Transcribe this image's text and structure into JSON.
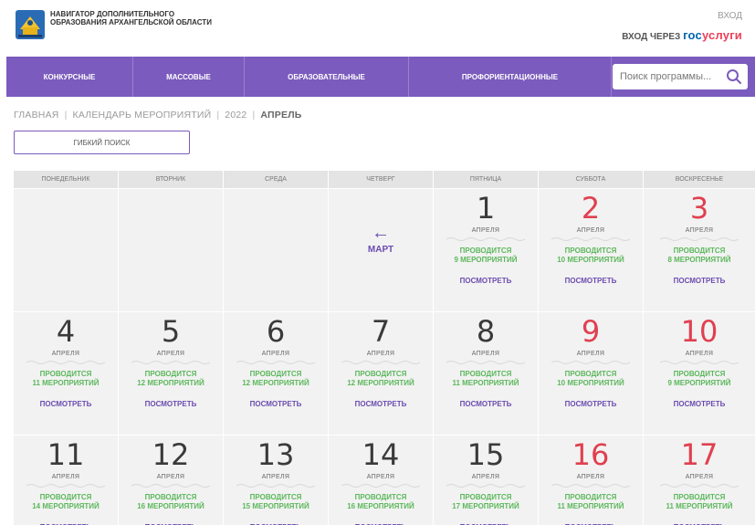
{
  "header": {
    "org_name": "НАВИГАТОР ДОПОЛНИТЕЛЬНОГО ОБРАЗОВАНИЯ АРХАНГЕЛЬСКОЙ ОБЛАСТИ",
    "login": "ВХОД",
    "login_via": "ВХОД ЧЕРЕЗ",
    "gos_part1": "гос",
    "gos_part2": "услуги"
  },
  "nav": {
    "items": [
      "КОНКУРСНЫЕ",
      "МАССОВЫЕ",
      "ОБРАЗОВАТЕЛЬНЫЕ",
      "ПРОФОРИЕНТАЦИОННЫЕ"
    ],
    "search_placeholder": "Поиск программы..."
  },
  "breadcrumb": {
    "items": [
      "ГЛАВНАЯ",
      "КАЛЕНДАРЬ МЕРОПРИЯТИЙ",
      "2022"
    ],
    "current": "АПРЕЛЬ"
  },
  "flex_search_label": "ГИБКИЙ ПОИСК",
  "calendar": {
    "weekdays": [
      "ПОНЕДЕЛЬНИК",
      "ВТОРНИК",
      "СРЕДА",
      "ЧЕТВЕРГ",
      "ПЯТНИЦА",
      "СУББОТА",
      "ВОСКРЕСЕНЬЕ"
    ],
    "prev_month_label": "МАРТ",
    "month_genitive": "АПРЕЛЯ",
    "events_prefix": "ПРОВОДИТСЯ",
    "view_label": "ПОСМОТРЕТЬ",
    "colors": {
      "weekday": "#3a3a3a",
      "weekend": "#e0404f",
      "events": "#5cb85c",
      "link": "#6b4bb0"
    },
    "days": [
      {
        "day": "1",
        "weekend": false,
        "events": "9 МЕРОПРИЯТИЙ"
      },
      {
        "day": "2",
        "weekend": true,
        "events": "10 МЕРОПРИЯТИЙ"
      },
      {
        "day": "3",
        "weekend": true,
        "events": "8 МЕРОПРИЯТИЙ"
      },
      {
        "day": "4",
        "weekend": false,
        "events": "11 МЕРОПРИЯТИЙ"
      },
      {
        "day": "5",
        "weekend": false,
        "events": "12 МЕРОПРИЯТИЙ"
      },
      {
        "day": "6",
        "weekend": false,
        "events": "12 МЕРОПРИЯТИЙ"
      },
      {
        "day": "7",
        "weekend": false,
        "events": "12 МЕРОПРИЯТИЙ"
      },
      {
        "day": "8",
        "weekend": false,
        "events": "11 МЕРОПРИЯТИЙ"
      },
      {
        "day": "9",
        "weekend": true,
        "events": "10 МЕРОПРИЯТИЙ"
      },
      {
        "day": "10",
        "weekend": true,
        "events": "9 МЕРОПРИЯТИЙ"
      },
      {
        "day": "11",
        "weekend": false,
        "events": "14 МЕРОПРИЯТИЙ"
      },
      {
        "day": "12",
        "weekend": false,
        "events": "16 МЕРОПРИЯТИЙ"
      },
      {
        "day": "13",
        "weekend": false,
        "events": "15 МЕРОПРИЯТИЙ"
      },
      {
        "day": "14",
        "weekend": false,
        "events": "16 МЕРОПРИЯТИЙ"
      },
      {
        "day": "15",
        "weekend": false,
        "events": "17 МЕРОПРИЯТИЙ"
      },
      {
        "day": "16",
        "weekend": true,
        "events": "11 МЕРОПРИЯТИЙ"
      },
      {
        "day": "17",
        "weekend": true,
        "events": "11 МЕРОПРИЯТИЙ"
      }
    ]
  }
}
